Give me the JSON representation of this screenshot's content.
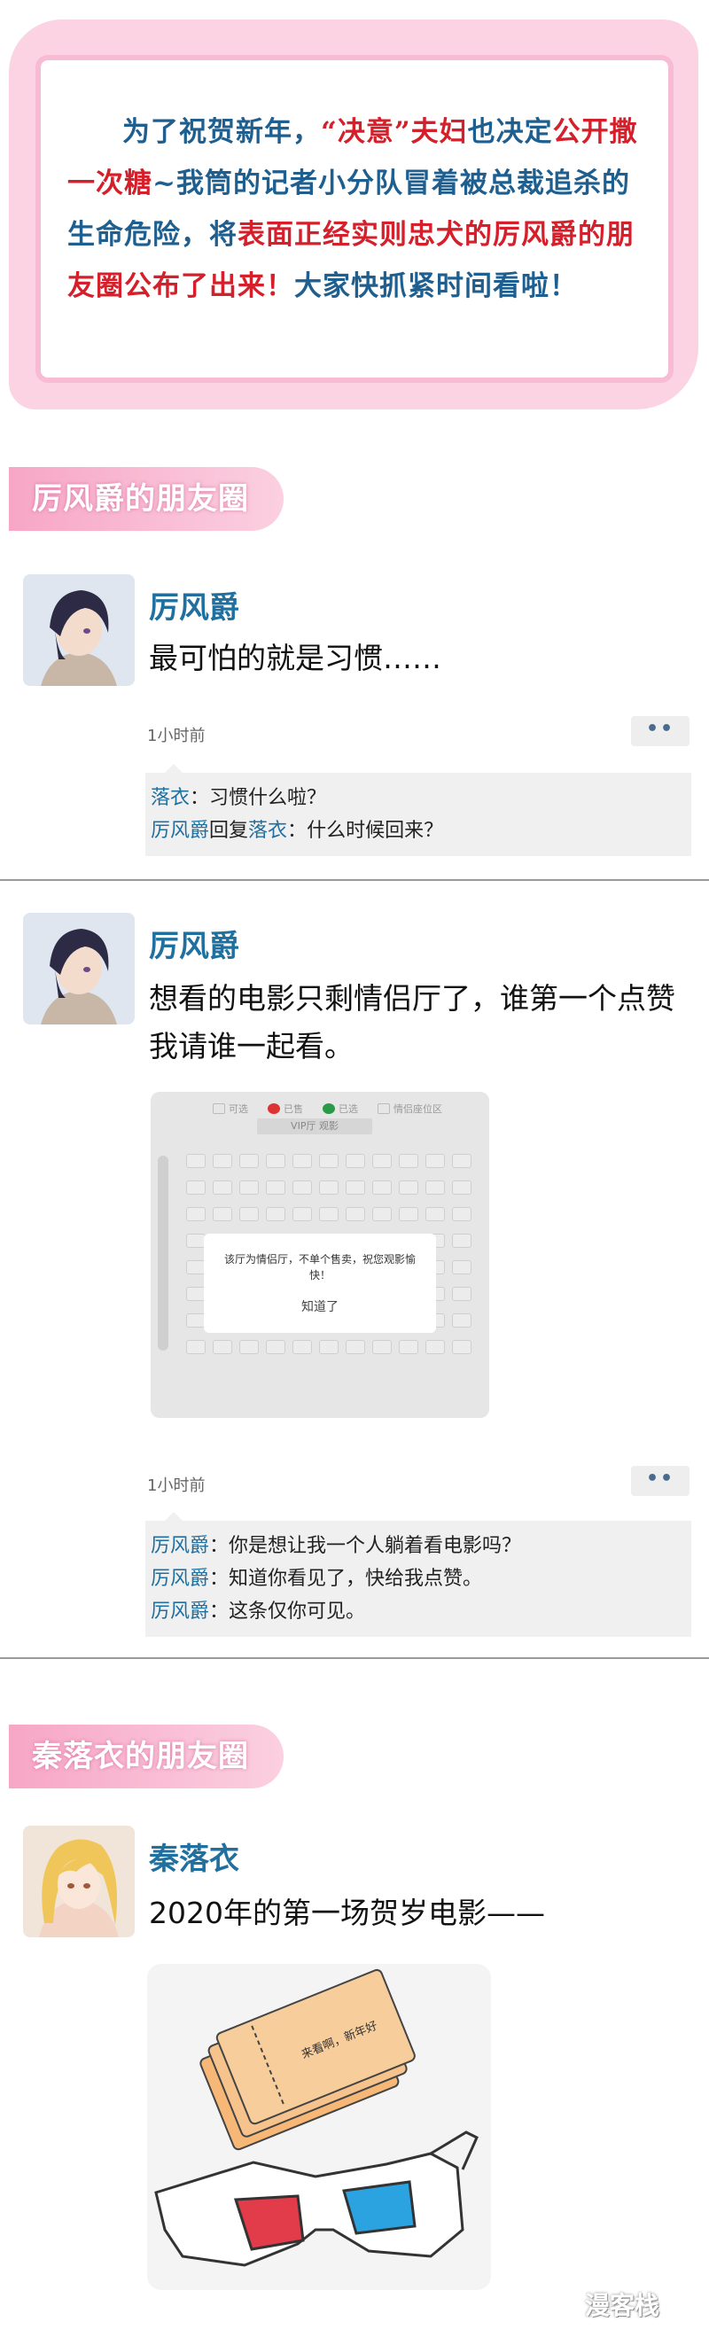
{
  "banner": {
    "seg1": "为了祝贺新年，",
    "seg2": "“决意”夫妇",
    "seg3": "也决定",
    "seg4": "公开撒一次糖",
    "seg5": "~我筒的记者小分队冒着被总裁追杀的生命危险，将",
    "seg6": "表面正经实则忠犬的厉风爵的朋友圈",
    "seg7": "公布了出来！",
    "seg8": "大家快抓紧时间看啦！"
  },
  "sections": [
    {
      "label": "厉风爵的朋友圈"
    },
    {
      "label": "秦落衣的朋友圈"
    }
  ],
  "posts": [
    {
      "name": "厉风爵",
      "text": "最可怕的就是习惯……",
      "time": "1小时前",
      "more": "••",
      "comments": [
        {
          "user": "落衣",
          "sep": "：",
          "text": "习惯什么啦？"
        },
        {
          "user": "厉风爵",
          "mid": "回复",
          "user2": "落衣",
          "sep": "：",
          "text": "什么时候回来？"
        }
      ]
    },
    {
      "name": "厉风爵",
      "text": "想看的电影只剩情侣厅了，谁第一个点赞我请谁一起看。",
      "time": "1小时前",
      "more": "••",
      "screenshot": {
        "legend": [
          "可选",
          "已售",
          "已选",
          "情侣座位区"
        ],
        "hall": "VIP厅 观影",
        "dialog_text": "该厅为情侣厅，不单个售卖，祝您观影愉快！",
        "dialog_button": "知道了"
      },
      "comments": [
        {
          "user": "厉风爵",
          "sep": "：",
          "text": "你是想让我一个人躺着看电影吗？"
        },
        {
          "user": "厉风爵",
          "sep": "：",
          "text": "知道你看见了，快给我点赞。"
        },
        {
          "user": "厉风爵",
          "sep": "：",
          "text": "这条仅你可见。"
        }
      ]
    },
    {
      "name": "秦落衣",
      "text": "2020年的第一场贺岁电影——",
      "illustration": {
        "ticket_text": "来看啊，新年好"
      }
    }
  ],
  "watermark": "漫客栈",
  "colors": {
    "pink": "#f7a6c6",
    "blue_name": "#1f6f9f",
    "red": "#d51f2a"
  }
}
